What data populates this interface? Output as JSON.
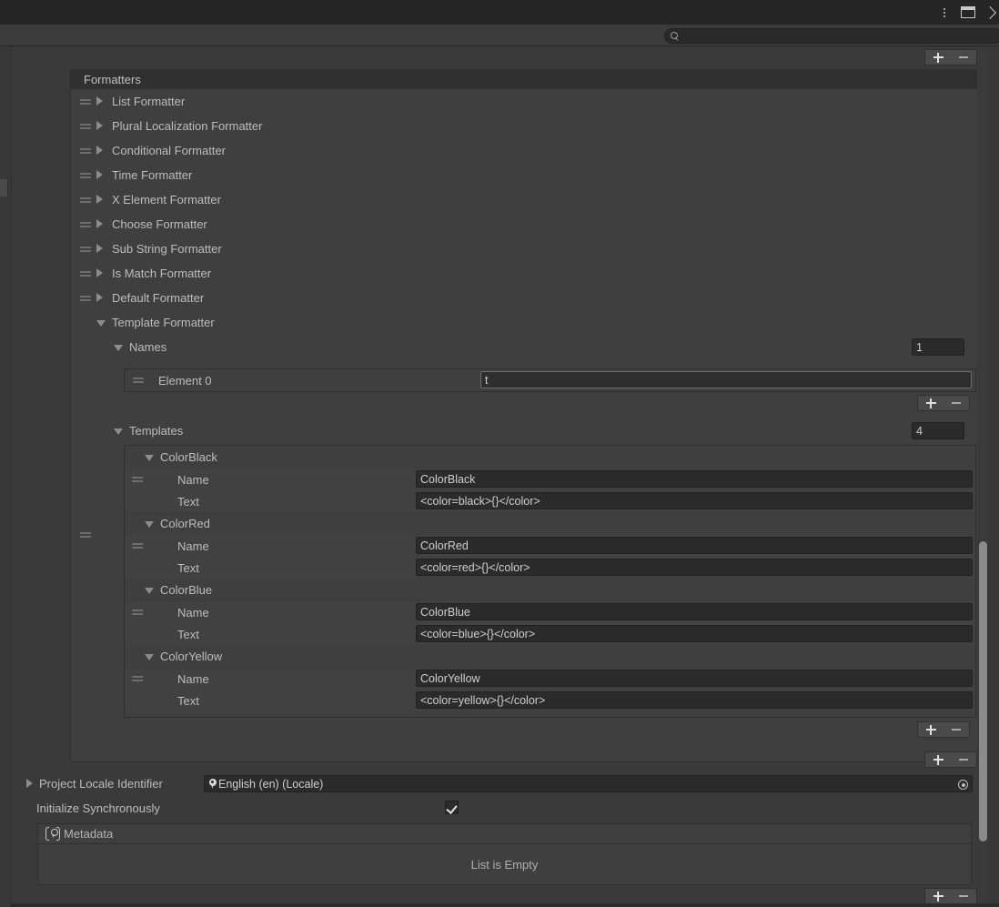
{
  "titlebar": {
    "icons": [
      "kebab-menu-icon",
      "panel-layout-icon",
      "chevron-right-icon"
    ]
  },
  "search": {
    "value": "",
    "placeholder": "",
    "icon": "search-icon"
  },
  "top_list_controls": {
    "add_label": "+",
    "remove_label": "-"
  },
  "formatters": {
    "header": "Formatters",
    "items": [
      {
        "label": "List Formatter",
        "expanded": false,
        "draggable": true
      },
      {
        "label": "Plural Localization Formatter",
        "expanded": false,
        "draggable": true
      },
      {
        "label": "Conditional Formatter",
        "expanded": false,
        "draggable": true
      },
      {
        "label": "Time Formatter",
        "expanded": false,
        "draggable": true
      },
      {
        "label": "X Element Formatter",
        "expanded": false,
        "draggable": true
      },
      {
        "label": "Choose Formatter",
        "expanded": false,
        "draggable": true
      },
      {
        "label": "Sub String Formatter",
        "expanded": false,
        "draggable": true
      },
      {
        "label": "Is Match Formatter",
        "expanded": false,
        "draggable": true
      },
      {
        "label": "Default Formatter",
        "expanded": false,
        "draggable": true
      },
      {
        "label": "Template Formatter",
        "expanded": true,
        "draggable": false
      }
    ]
  },
  "names": {
    "label": "Names",
    "count": "1",
    "elements": [
      {
        "label": "Element 0",
        "value": "t",
        "focused": true
      }
    ],
    "add_label": "+",
    "remove_label": "-"
  },
  "templates": {
    "label": "Templates",
    "count": "4",
    "field_labels": {
      "name": "Name",
      "text": "Text"
    },
    "items": [
      {
        "title": "ColorBlack",
        "name": "ColorBlack",
        "text": "<color=black>{}</color>"
      },
      {
        "title": "ColorRed",
        "name": "ColorRed",
        "text": "<color=red>{}</color>"
      },
      {
        "title": "ColorBlue",
        "name": "ColorBlue",
        "text": "<color=blue>{}</color>"
      },
      {
        "title": "ColorYellow",
        "name": "ColorYellow",
        "text": "<color=yellow>{}</color>"
      }
    ],
    "add_label": "+",
    "remove_label": "-"
  },
  "formatters_footer": {
    "add_label": "+",
    "remove_label": "-"
  },
  "project_locale": {
    "label": "Project Locale Identifier",
    "value": "English (en) (Locale)",
    "icon": "locale-pin-icon",
    "picker_icon": "object-picker-icon",
    "expanded": false
  },
  "initialize_synchronously": {
    "label": "Initialize Synchronously",
    "checked": true
  },
  "metadata": {
    "header": "Metadata",
    "icon": "metadata-locale-icon",
    "empty_text": "List is Empty",
    "add_label": "+",
    "remove_label": "-"
  }
}
